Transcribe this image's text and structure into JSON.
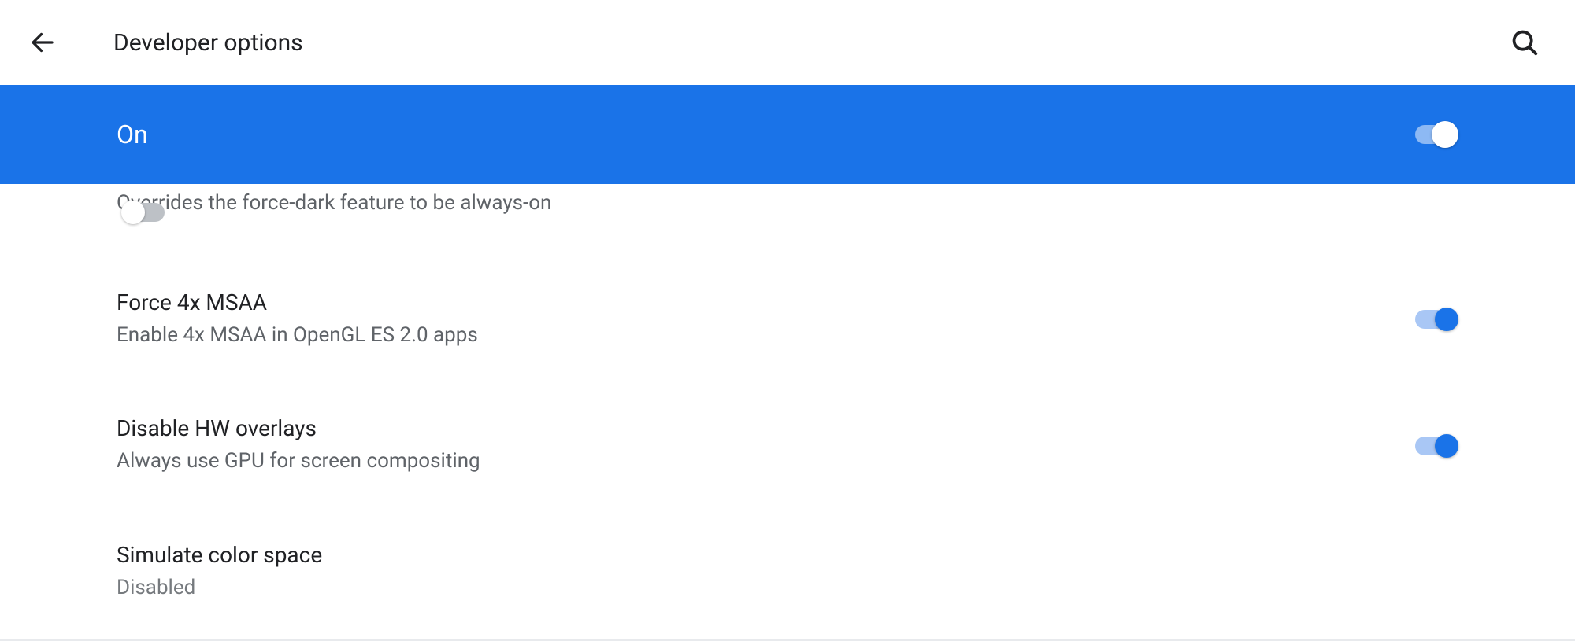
{
  "topbar": {
    "title": "Developer options"
  },
  "banner": {
    "label": "On",
    "state": "on"
  },
  "partial": {
    "description": "Overrides the force-dark feature to be always-on",
    "state": "off"
  },
  "settings": [
    {
      "title": "Force 4x MSAA",
      "description": "Enable 4x MSAA in OpenGL ES 2.0 apps",
      "state": "on"
    },
    {
      "title": "Disable HW overlays",
      "description": "Always use GPU for screen compositing",
      "state": "on"
    },
    {
      "title": "Simulate color space",
      "description": "Disabled"
    }
  ]
}
